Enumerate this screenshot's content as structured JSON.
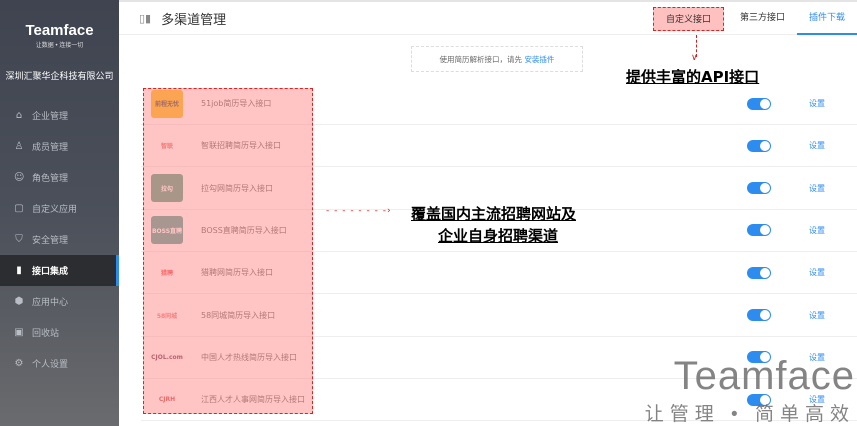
{
  "sidebar": {
    "logo": "Teamface",
    "logo_tagline": "让数据 • 连接一切",
    "company": "深圳汇聚华企科技有限公司",
    "items": [
      {
        "label": "企业管理",
        "icon": "building-icon"
      },
      {
        "label": "成员管理",
        "icon": "user-icon"
      },
      {
        "label": "角色管理",
        "icon": "role-icon"
      },
      {
        "label": "自定义应用",
        "icon": "cube-icon"
      },
      {
        "label": "安全管理",
        "icon": "shield-icon"
      },
      {
        "label": "接口集成",
        "icon": "interface-icon",
        "active": true
      },
      {
        "label": "应用中心",
        "icon": "app-icon"
      },
      {
        "label": "回收站",
        "icon": "trash-icon"
      },
      {
        "label": "个人设置",
        "icon": "gear-icon"
      }
    ]
  },
  "header": {
    "title": "多渠道管理",
    "tabs": [
      {
        "label": "自定义接口"
      },
      {
        "label": "第三方接口"
      },
      {
        "label": "插件下载",
        "active": true
      }
    ]
  },
  "notice": {
    "text": "使用简历解析接口，请先 ",
    "link": "安装插件"
  },
  "callouts": {
    "api": "提供丰富的API接口",
    "coverage_line1": "覆盖国内主流招聘网站及",
    "coverage_line2": "企业自身招聘渠道"
  },
  "rows": [
    {
      "name": "51job简历导入接口",
      "logo": "前程无忧",
      "enabled": true,
      "action": "设置"
    },
    {
      "name": "智联招聘简历导入接口",
      "logo": "智联",
      "enabled": true,
      "action": "设置"
    },
    {
      "name": "拉勾网简历导入接口",
      "logo": "拉勾",
      "enabled": true,
      "action": "设置"
    },
    {
      "name": "BOSS直聘简历导入接口",
      "logo": "BOSS直聘",
      "enabled": true,
      "action": "设置"
    },
    {
      "name": "猎聘网简历导入接口",
      "logo": "猎聘",
      "enabled": true,
      "action": "设置"
    },
    {
      "name": "58同城简历导入接口",
      "logo": "58同城",
      "enabled": true,
      "action": "设置"
    },
    {
      "name": "中国人才热线简历导入接口",
      "logo": "CJOL.com",
      "enabled": true,
      "action": "设置"
    },
    {
      "name": "江西人才人事网简历导入接口",
      "logo": "CJRH",
      "enabled": true,
      "action": "设置"
    }
  ],
  "watermark": {
    "brand": "Teamface",
    "slogan": "让管理 • 简单高效"
  },
  "colors": {
    "accent": "#2d8cf0",
    "highlight": "#ffc0c0"
  }
}
